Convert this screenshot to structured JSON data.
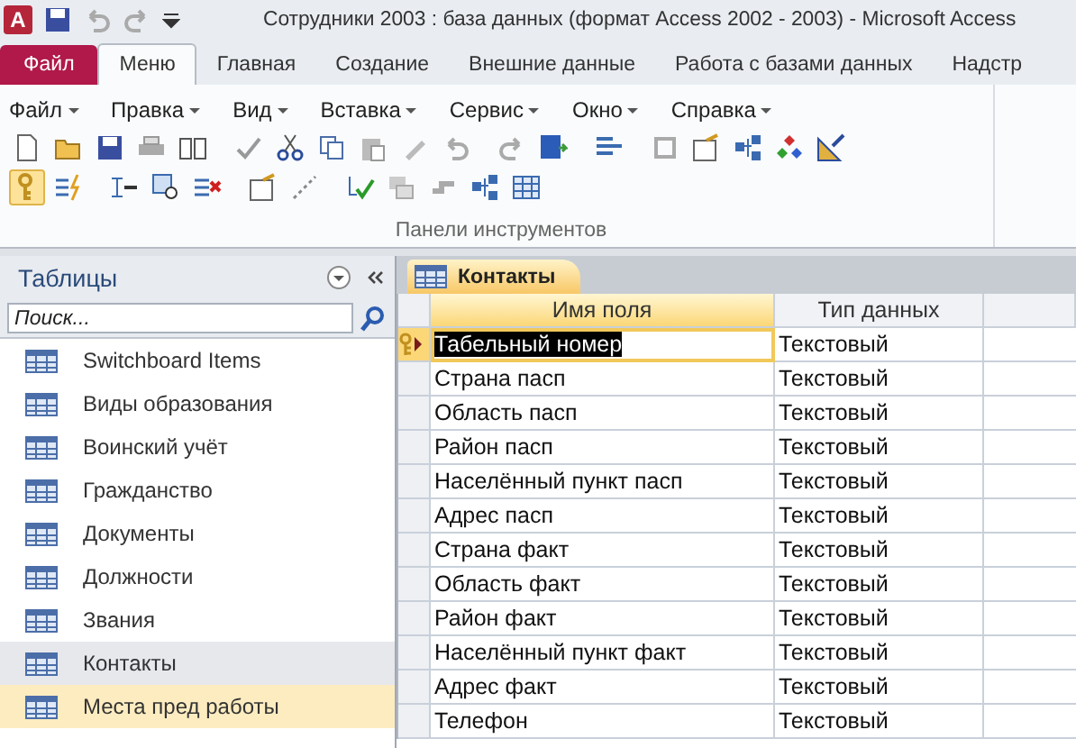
{
  "window": {
    "app_icon_letter": "A",
    "title": "Сотрудники 2003 : база данных (формат Access 2002 - 2003)  -  Microsoft Access"
  },
  "ribbon_tabs": [
    {
      "label": "Файл",
      "kind": "file",
      "selected": false
    },
    {
      "label": "Меню",
      "kind": "tab",
      "selected": true
    },
    {
      "label": "Главная",
      "kind": "tab",
      "selected": false
    },
    {
      "label": "Создание",
      "kind": "tab",
      "selected": false
    },
    {
      "label": "Внешние данные",
      "kind": "tab",
      "selected": false
    },
    {
      "label": "Работа с базами данных",
      "kind": "tab",
      "selected": false
    },
    {
      "label": "Надстр",
      "kind": "tab",
      "selected": false
    }
  ],
  "menus": [
    "Файл",
    "Правка",
    "Вид",
    "Вставка",
    "Сервис",
    "Окно",
    "Справка"
  ],
  "toolbar": {
    "key_button": {
      "selected": true
    },
    "group_label": "Панели инструментов"
  },
  "navigation": {
    "title": "Таблицы",
    "search": {
      "placeholder": "Поиск..."
    },
    "items": [
      {
        "label": "Switchboard Items",
        "selected": false,
        "hovered": false
      },
      {
        "label": "Виды образования",
        "selected": false,
        "hovered": false
      },
      {
        "label": "Воинский учёт",
        "selected": false,
        "hovered": false
      },
      {
        "label": "Гражданство",
        "selected": false,
        "hovered": false
      },
      {
        "label": "Документы",
        "selected": false,
        "hovered": false
      },
      {
        "label": "Должности",
        "selected": false,
        "hovered": false
      },
      {
        "label": "Звания",
        "selected": false,
        "hovered": false
      },
      {
        "label": "Контакты",
        "selected": true,
        "hovered": false
      },
      {
        "label": "Места пред работы",
        "selected": false,
        "hovered": true
      }
    ]
  },
  "document": {
    "tab": "Контакты",
    "columns": [
      "Имя поля",
      "Тип данных"
    ],
    "rows": [
      {
        "field": "Табельный номер",
        "type": "Текстовый",
        "selected": true,
        "primary_key": true
      },
      {
        "field": "Страна пасп",
        "type": "Текстовый",
        "selected": false,
        "primary_key": false
      },
      {
        "field": "Область пасп",
        "type": "Текстовый",
        "selected": false,
        "primary_key": false
      },
      {
        "field": "Район пасп",
        "type": "Текстовый",
        "selected": false,
        "primary_key": false
      },
      {
        "field": "Населённый пункт пасп",
        "type": "Текстовый",
        "selected": false,
        "primary_key": false
      },
      {
        "field": "Адрес пасп",
        "type": "Текстовый",
        "selected": false,
        "primary_key": false
      },
      {
        "field": "Страна факт",
        "type": "Текстовый",
        "selected": false,
        "primary_key": false
      },
      {
        "field": "Область факт",
        "type": "Текстовый",
        "selected": false,
        "primary_key": false
      },
      {
        "field": "Район факт",
        "type": "Текстовый",
        "selected": false,
        "primary_key": false
      },
      {
        "field": "Населённый пункт факт",
        "type": "Текстовый",
        "selected": false,
        "primary_key": false
      },
      {
        "field": "Адрес факт",
        "type": "Текстовый",
        "selected": false,
        "primary_key": false
      },
      {
        "field": "Телефон",
        "type": "Текстовый",
        "selected": false,
        "primary_key": false
      }
    ]
  }
}
